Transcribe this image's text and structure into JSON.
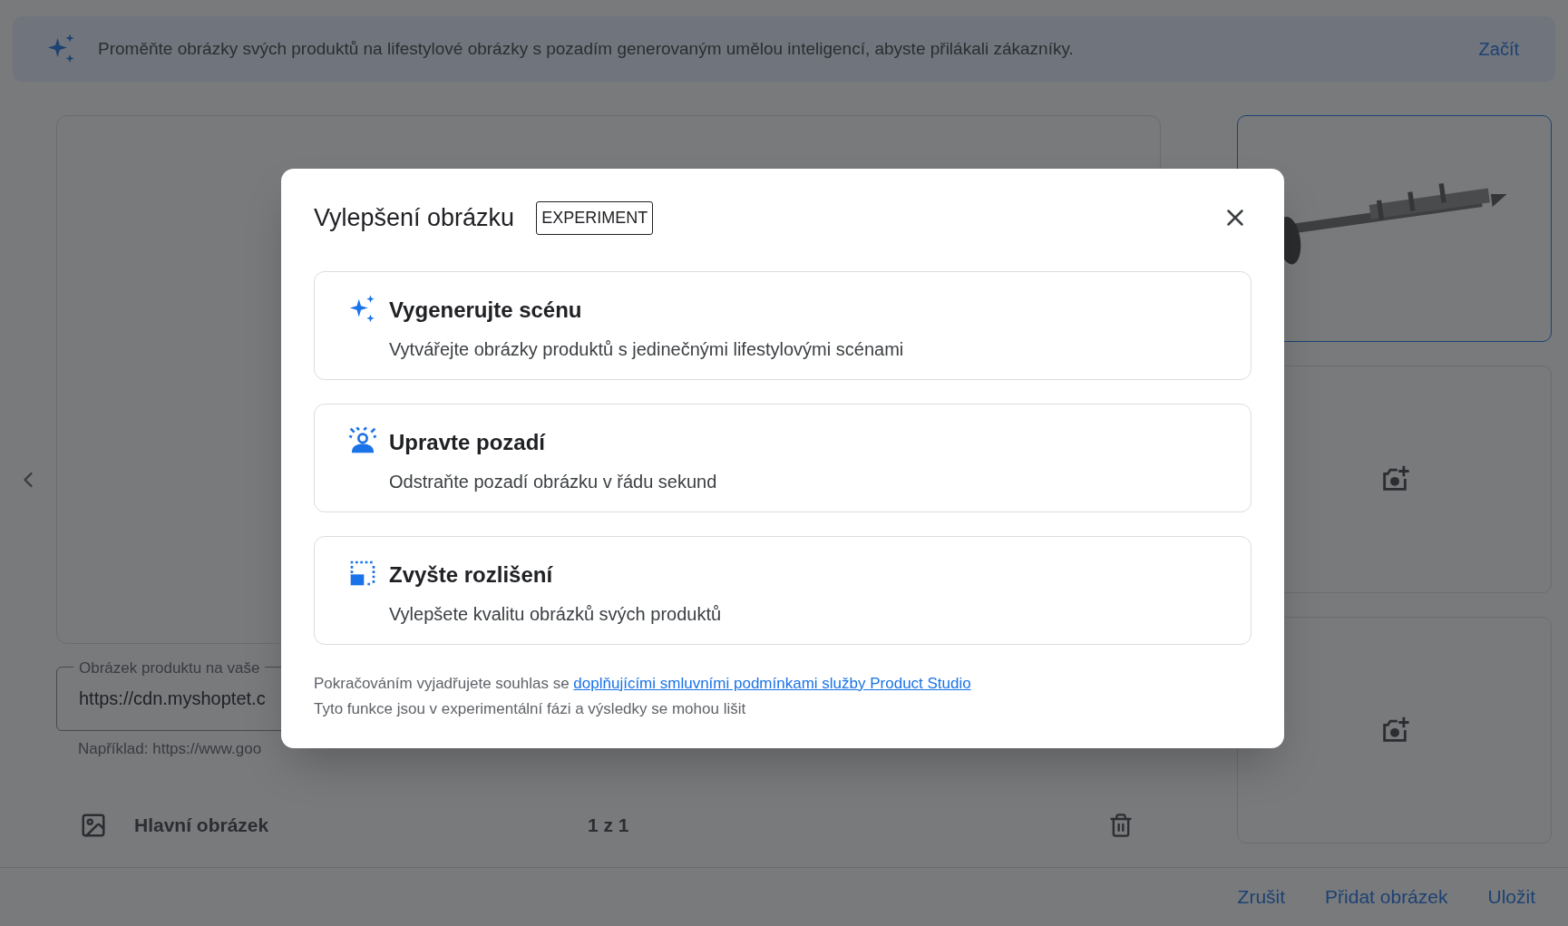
{
  "banner": {
    "text": "Proměňte obrázky svých produktů na lifestylové obrázky s pozadím generovaným umělou inteligencí, abyste přilákali zákazníky.",
    "action": "Začít"
  },
  "image_field": {
    "label": "Obrázek produktu na vaše",
    "value": "https://cdn.myshoptet.c",
    "hint": "Například: https://www.goo"
  },
  "image_row": {
    "label": "Hlavní obrázek",
    "count": "1 z 1"
  },
  "thumbnails": [
    {
      "kind": "picture",
      "selected": true
    },
    {
      "kind": "empty",
      "selected": false
    },
    {
      "kind": "empty",
      "selected": false
    }
  ],
  "footer_buttons": [
    "Zrušit",
    "Přidat obrázek",
    "Uložit"
  ],
  "dialog": {
    "title": "Vylepšení obrázku",
    "badge": "EXPERIMENT",
    "options": [
      {
        "kind": "scene",
        "title": "Vygenerujte scénu",
        "description": "Vytvářejte obrázky produktů s jedinečnými lifestylovými scénami"
      },
      {
        "kind": "background",
        "title": "Upravte pozadí",
        "description": "Odstraňte pozadí obrázku v řádu sekund"
      },
      {
        "kind": "resolution",
        "title": "Zvyšte rozlišení",
        "description": "Vylepšete kvalitu obrázků svých produktů"
      }
    ],
    "consent": {
      "prefix": "Pokračováním vyjadřujete souhlas se",
      "link": "doplňujícími smluvními podmínkami služby Product Studio"
    },
    "note": "Tyto funkce jsou v experimentální fázi a výsledky se mohou lišit"
  }
}
